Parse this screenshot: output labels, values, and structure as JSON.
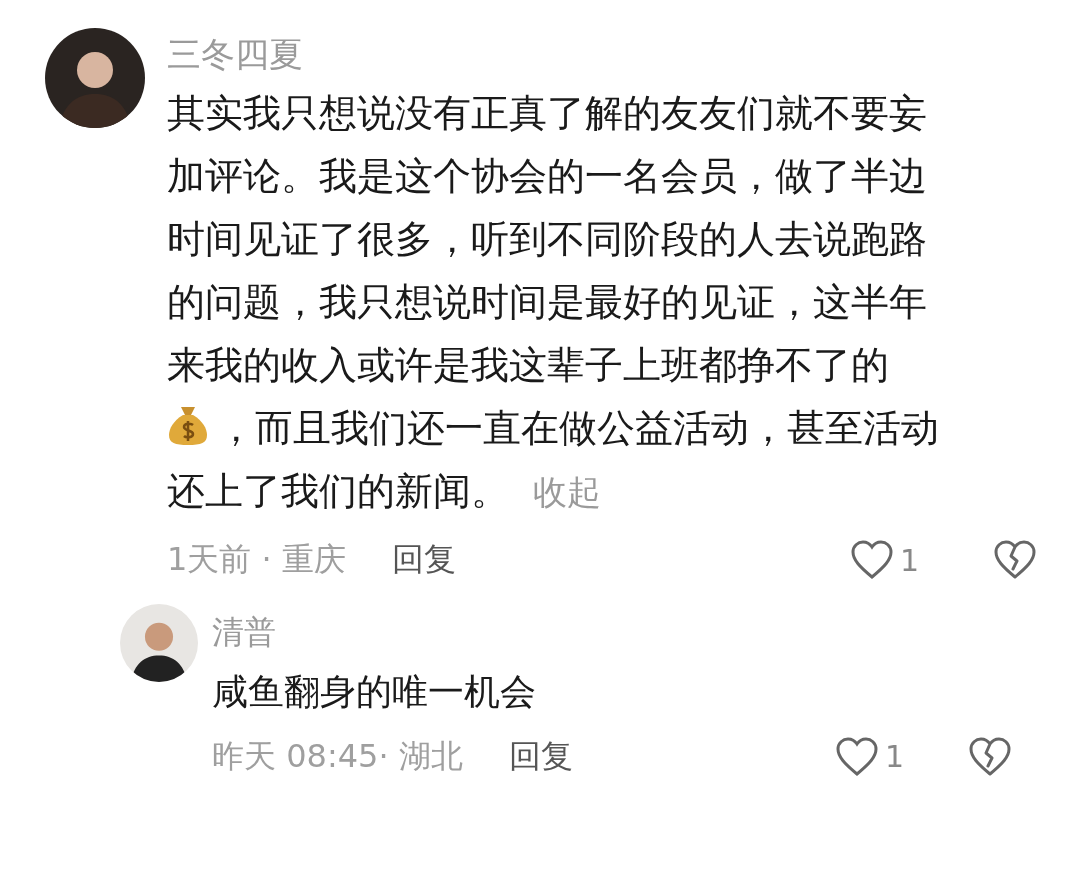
{
  "comments": [
    {
      "author": "三冬四夏",
      "lines": [
        {
          "kind": "text",
          "text": "其实我只想说没有正真了解的友友们就不要妄"
        },
        {
          "kind": "text",
          "text": "加评论。我是这个协会的一名会员，做了半边"
        },
        {
          "kind": "text",
          "text": "时间见证了很多，听到不同阶段的人去说跑路"
        },
        {
          "kind": "text",
          "text": "的问题，我只想说时间是最好的见证，这半年"
        },
        {
          "kind": "text",
          "text": "来我的收入或许是我这辈子上班都挣不了的"
        },
        {
          "kind": "money_bag",
          "text": "，而且我们还一直在做公益活动，甚至活动"
        },
        {
          "kind": "text",
          "text": "还上了我们的新闻。"
        }
      ],
      "collapse_link": "收起",
      "meta": "1天前 · 重庆",
      "reply_label": "回复",
      "like_count": "1",
      "liked": false,
      "children": [
        {
          "author": "清普",
          "lines": [
            {
              "kind": "text",
              "text": "咸鱼翻身的唯一机会"
            }
          ],
          "meta": "昨天 08:45· 湖北",
          "reply_label": "回复",
          "like_count": "1",
          "liked": false
        }
      ]
    }
  ]
}
